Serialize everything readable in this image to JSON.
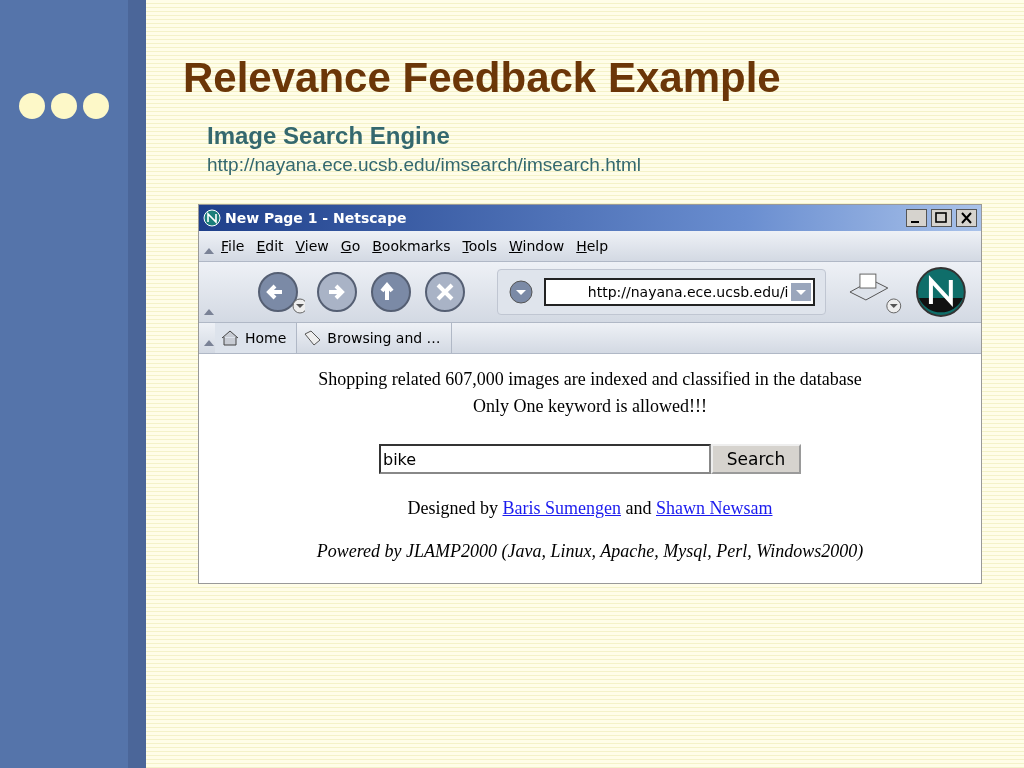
{
  "slide": {
    "title": "Relevance Feedback Example",
    "subtitle": "Image Search Engine",
    "url": "http://nayana.ece.ucsb.edu/imsearch/imsearch.html"
  },
  "browser": {
    "title": "New Page 1 - Netscape",
    "menu": [
      "File",
      "Edit",
      "View",
      "Go",
      "Bookmarks",
      "Tools",
      "Window",
      "Help"
    ],
    "address": "http://nayana.ece.ucsb.edu/i",
    "bookmarks": [
      {
        "kind": "home",
        "label": "Home"
      },
      {
        "kind": "folder",
        "label": "Browsing and …"
      }
    ],
    "page": {
      "lines": [
        "Shopping related 607,000 images are indexed and classified in the database",
        "Only One keyword is allowed!!!"
      ],
      "search": {
        "value": "bike",
        "button": "Search"
      },
      "credits": [
        {
          "kind": "text",
          "text": "Designed by"
        },
        {
          "kind": "link",
          "text": "Baris Sumengen"
        },
        {
          "kind": "text",
          "text": "and"
        },
        {
          "kind": "link",
          "text": "Shawn Newsam"
        }
      ],
      "footer": "Powered by JLAMP2000 (Java, Linux, Apache, Mysql, Perl, Windows2000)"
    }
  }
}
